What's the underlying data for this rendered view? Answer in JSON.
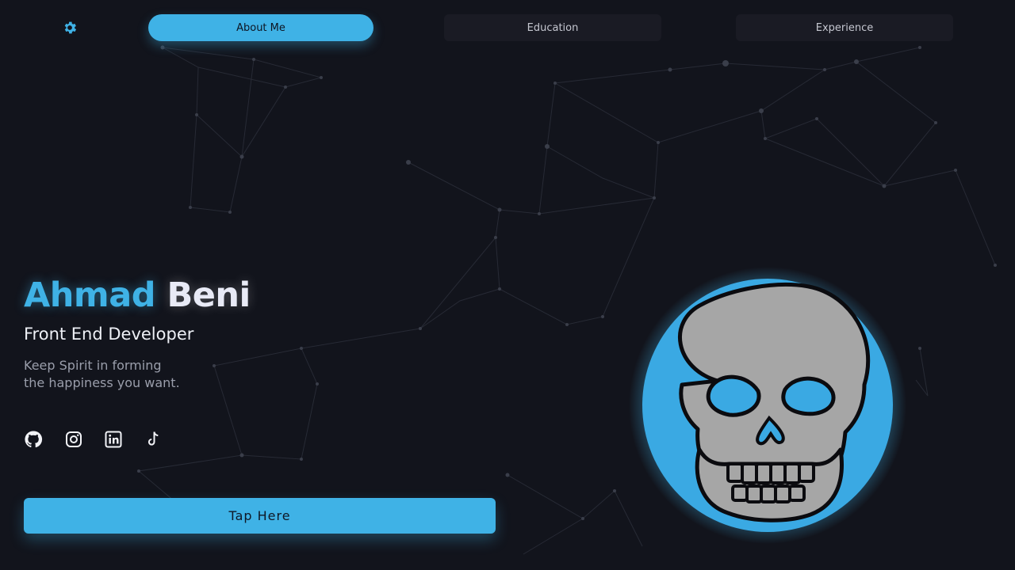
{
  "nav": {
    "settings_icon": "gear-icon",
    "tabs": [
      {
        "label": "About Me",
        "active": true
      },
      {
        "label": "Education",
        "active": false
      },
      {
        "label": "Experience",
        "active": false
      }
    ]
  },
  "hero": {
    "first_name": "Ahmad",
    "last_name": "Beni",
    "role": "Front End Developer",
    "tagline_line1": "Keep Spirit in forming",
    "tagline_line2": "the happiness you want."
  },
  "social": [
    "github-icon",
    "instagram-icon",
    "linkedin-icon",
    "tiktok-icon"
  ],
  "cta": {
    "label": "Tap Here"
  },
  "avatar": {
    "icon": "skull-icon"
  },
  "colors": {
    "background": "#12141c",
    "accent": "#3fb2e6",
    "text": "#eef0f6",
    "muted": "#9a9eab"
  }
}
